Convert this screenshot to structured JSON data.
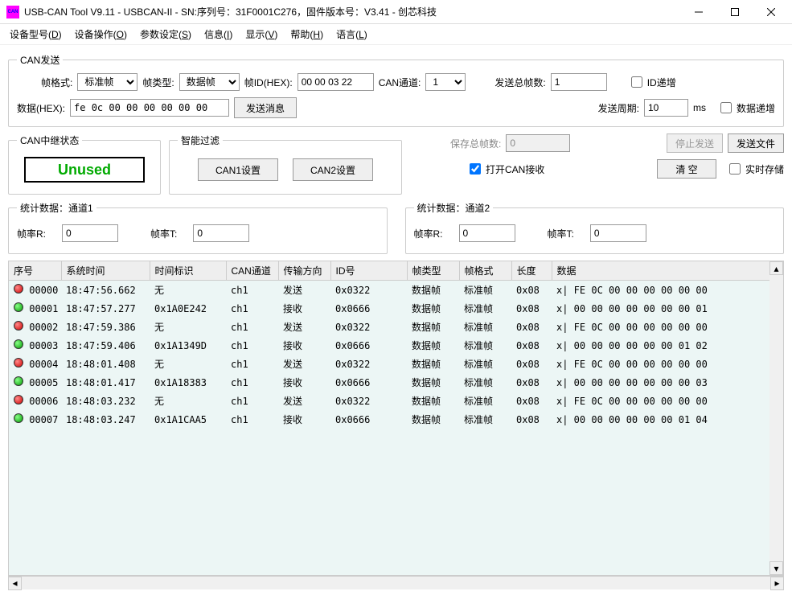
{
  "window": {
    "title": "USB-CAN Tool V9.11 - USBCAN-II - SN:序列号：31F0001C276，固件版本号：V3.41 - 创芯科技"
  },
  "menus": [
    {
      "label": "设备型号",
      "key": "D"
    },
    {
      "label": "设备操作",
      "key": "O"
    },
    {
      "label": "参数设定",
      "key": "S"
    },
    {
      "label": "信息",
      "key": "I"
    },
    {
      "label": "显示",
      "key": "V"
    },
    {
      "label": "帮助",
      "key": "H"
    },
    {
      "label": "语言",
      "key": "L"
    }
  ],
  "send": {
    "legend": "CAN发送",
    "frame_fmt_label": "帧格式:",
    "frame_fmt_value": "标准帧",
    "frame_type_label": "帧类型:",
    "frame_type_value": "数据帧",
    "frame_id_label": "帧ID(HEX):",
    "frame_id_value": "00 00 03 22",
    "can_ch_label": "CAN通道:",
    "can_ch_value": "1",
    "total_frames_label": "发送总帧数:",
    "total_frames_value": "1",
    "id_inc_label": "ID递增",
    "data_label": "数据(HEX):",
    "data_value": "fe 0c 00 00 00 00 00 00",
    "send_msg_btn": "发送消息",
    "send_period_label": "发送周期:",
    "send_period_value": "10",
    "ms_label": "ms",
    "data_inc_label": "数据递增"
  },
  "relay": {
    "legend": "CAN中继状态",
    "status": "Unused"
  },
  "filter": {
    "legend": "智能过滤",
    "can1_btn": "CAN1设置",
    "can2_btn": "CAN2设置"
  },
  "rctrl": {
    "save_total_label": "保存总帧数:",
    "save_total_value": "0",
    "open_recv_label": "打开CAN接收",
    "stop_send_btn": "停止发送",
    "send_file_btn": "发送文件",
    "clear_btn": "清 空",
    "rt_save_label": "实时存储"
  },
  "stats1": {
    "legend": "统计数据：通道1",
    "rate_r_label": "帧率R:",
    "rate_r_value": "0",
    "rate_t_label": "帧率T:",
    "rate_t_value": "0"
  },
  "stats2": {
    "legend": "统计数据：通道2",
    "rate_r_label": "帧率R:",
    "rate_r_value": "0",
    "rate_t_label": "帧率T:",
    "rate_t_value": "0"
  },
  "table": {
    "headers": {
      "seq": "序号",
      "systime": "系统时间",
      "timemark": "时间标识",
      "chan": "CAN通道",
      "dir": "传输方向",
      "id": "ID号",
      "ftype": "帧类型",
      "ffmt": "帧格式",
      "len": "长度",
      "data": "数据"
    },
    "rows": [
      {
        "status": "red",
        "seq": "00000",
        "systime": "18:47:56.662",
        "timemark": "无",
        "chan": "ch1",
        "dir": "发送",
        "id": "0x0322",
        "ftype": "数据帧",
        "ffmt": "标准帧",
        "len": "0x08",
        "data": "x| FE 0C 00 00 00 00 00 00"
      },
      {
        "status": "green",
        "seq": "00001",
        "systime": "18:47:57.277",
        "timemark": "0x1A0E242",
        "chan": "ch1",
        "dir": "接收",
        "id": "0x0666",
        "ftype": "数据帧",
        "ffmt": "标准帧",
        "len": "0x08",
        "data": "x| 00 00 00 00 00 00 00 01"
      },
      {
        "status": "red",
        "seq": "00002",
        "systime": "18:47:59.386",
        "timemark": "无",
        "chan": "ch1",
        "dir": "发送",
        "id": "0x0322",
        "ftype": "数据帧",
        "ffmt": "标准帧",
        "len": "0x08",
        "data": "x| FE 0C 00 00 00 00 00 00"
      },
      {
        "status": "green",
        "seq": "00003",
        "systime": "18:47:59.406",
        "timemark": "0x1A1349D",
        "chan": "ch1",
        "dir": "接收",
        "id": "0x0666",
        "ftype": "数据帧",
        "ffmt": "标准帧",
        "len": "0x08",
        "data": "x| 00 00 00 00 00 00 01 02"
      },
      {
        "status": "red",
        "seq": "00004",
        "systime": "18:48:01.408",
        "timemark": "无",
        "chan": "ch1",
        "dir": "发送",
        "id": "0x0322",
        "ftype": "数据帧",
        "ffmt": "标准帧",
        "len": "0x08",
        "data": "x| FE 0C 00 00 00 00 00 00"
      },
      {
        "status": "green",
        "seq": "00005",
        "systime": "18:48:01.417",
        "timemark": "0x1A18383",
        "chan": "ch1",
        "dir": "接收",
        "id": "0x0666",
        "ftype": "数据帧",
        "ffmt": "标准帧",
        "len": "0x08",
        "data": "x| 00 00 00 00 00 00 00 03"
      },
      {
        "status": "red",
        "seq": "00006",
        "systime": "18:48:03.232",
        "timemark": "无",
        "chan": "ch1",
        "dir": "发送",
        "id": "0x0322",
        "ftype": "数据帧",
        "ffmt": "标准帧",
        "len": "0x08",
        "data": "x| FE 0C 00 00 00 00 00 00"
      },
      {
        "status": "green",
        "seq": "00007",
        "systime": "18:48:03.247",
        "timemark": "0x1A1CAA5",
        "chan": "ch1",
        "dir": "接收",
        "id": "0x0666",
        "ftype": "数据帧",
        "ffmt": "标准帧",
        "len": "0x08",
        "data": "x| 00 00 00 00 00 00 01 04"
      }
    ]
  }
}
